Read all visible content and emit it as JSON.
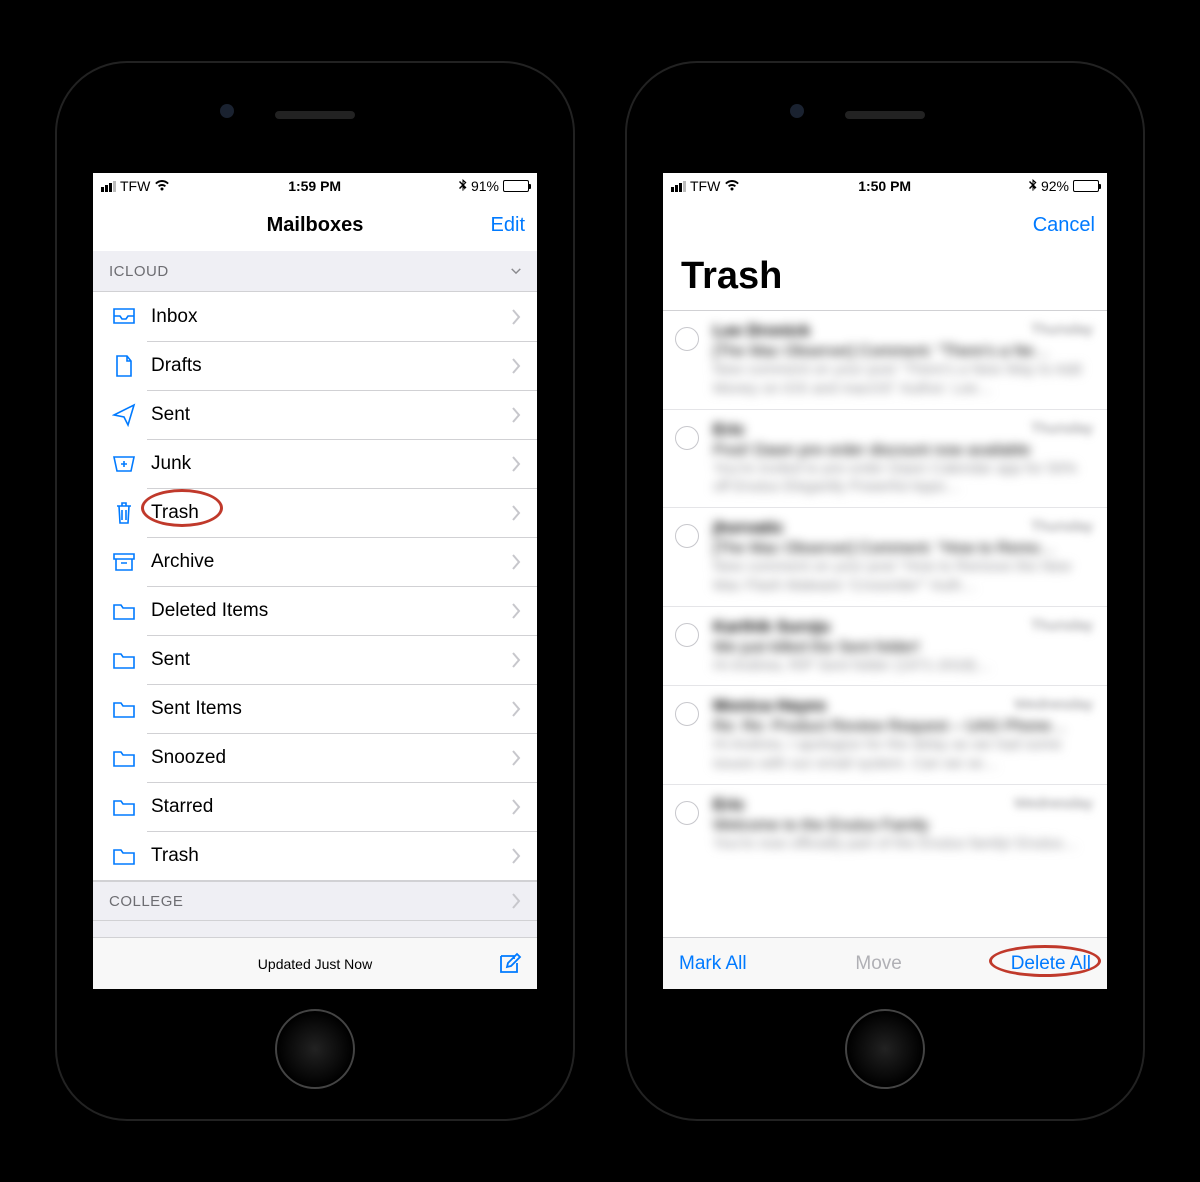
{
  "left": {
    "status": {
      "carrier": "TFW",
      "time": "1:59 PM",
      "battery_pct": "91%"
    },
    "nav": {
      "title": "Mailboxes",
      "right": "Edit"
    },
    "section1_header": "ICLOUD",
    "mailboxes": [
      {
        "label": "Inbox",
        "icon": "inbox"
      },
      {
        "label": "Drafts",
        "icon": "draft"
      },
      {
        "label": "Sent",
        "icon": "sent"
      },
      {
        "label": "Junk",
        "icon": "junk"
      },
      {
        "label": "Trash",
        "icon": "trash"
      },
      {
        "label": "Archive",
        "icon": "archive"
      },
      {
        "label": "Deleted Items",
        "icon": "folder"
      },
      {
        "label": "Sent",
        "icon": "folder"
      },
      {
        "label": "Sent Items",
        "icon": "folder"
      },
      {
        "label": "Snoozed",
        "icon": "folder"
      },
      {
        "label": "Starred",
        "icon": "folder"
      },
      {
        "label": "Trash",
        "icon": "folder"
      }
    ],
    "section2_header": "COLLEGE",
    "toolbar_status": "Updated Just Now"
  },
  "right": {
    "status": {
      "carrier": "TFW",
      "time": "1:50 PM",
      "battery_pct": "92%"
    },
    "nav": {
      "right": "Cancel"
    },
    "large_title": "Trash",
    "emails": [
      {
        "from": "Lee Dronick",
        "date": "Thursday",
        "subject": "[The Mac Observer] Comment: \"There's a Ne…",
        "preview": "New comment on your post \"There's a New Way to Add Money on iOS and macOS\" Author: Lee…"
      },
      {
        "from": "Eric",
        "date": "Thursday",
        "subject": "Post! Dawn pre-order discount now available",
        "preview": "You're invited to pre-order Dawn Calendar app for 50% off Enulus Elegantly Powerful Apps…"
      },
      {
        "from": "jhorvatic",
        "date": "Thursday",
        "subject": "[The Mac Observer] Comment: \"How to Remo…",
        "preview": "New comment on your post \"How to Remove the New Mac Flash Malware 'Crossrider'\" Auth…"
      },
      {
        "from": "Karthik Suroju",
        "date": "Thursday",
        "subject": "We just killed the Sent folder!",
        "preview": "Hi Andrew,\nRIP Sent folder (1971-2018)…"
      },
      {
        "from": "Monica Hayes",
        "date": "Wednesday",
        "subject": "Re: Re: Product Review Request – UAG Phone…",
        "preview": "Hi Andrew, I apologize for the delay as we had some issues with our email system. Can we se…"
      },
      {
        "from": "Eric",
        "date": "Wednesday",
        "subject": "Welcome to the Enulus Family",
        "preview": "You're now officially part of the Enulus family! Enulus…"
      }
    ],
    "toolbar": {
      "mark_all": "Mark All",
      "move": "Move",
      "delete_all": "Delete All"
    }
  }
}
